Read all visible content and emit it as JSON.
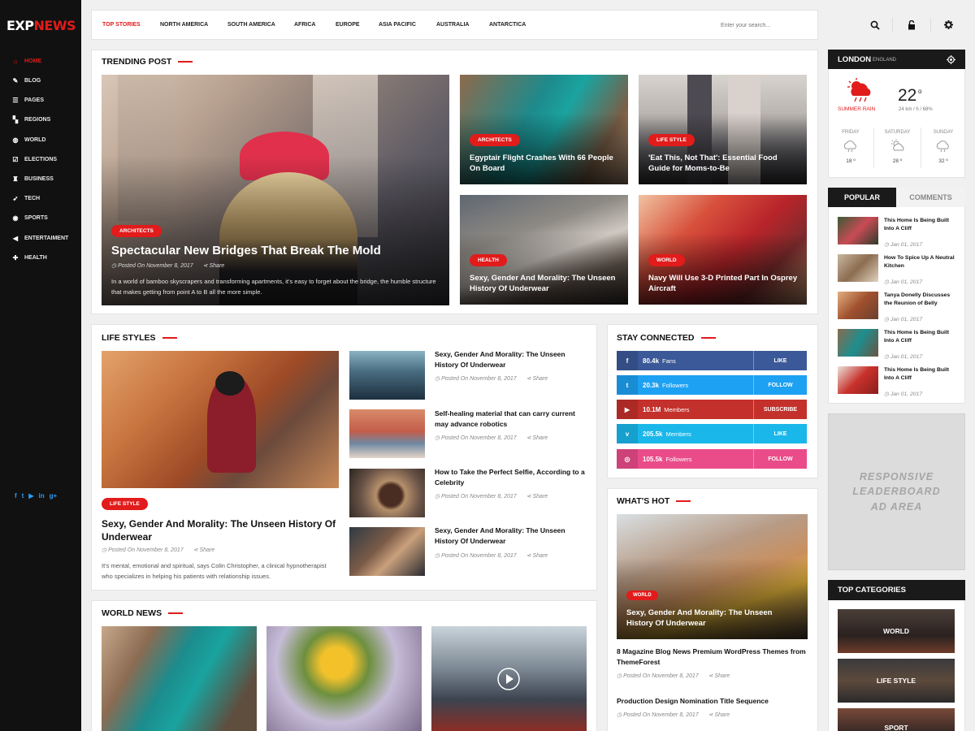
{
  "brand": {
    "logo_left": "EXP",
    "logo_right": "NEWS",
    "accent": "#e21b1b"
  },
  "sidebar": {
    "items": [
      {
        "label": "Home",
        "icon": "home-icon",
        "glyph": "⌂"
      },
      {
        "label": "Blog",
        "icon": "edit-icon",
        "glyph": "✎"
      },
      {
        "label": "Pages",
        "icon": "pages-icon",
        "glyph": "☰"
      },
      {
        "label": "Regions",
        "icon": "map-icon",
        "glyph": "▚"
      },
      {
        "label": "World",
        "icon": "globe-icon",
        "glyph": "◍"
      },
      {
        "label": "Elections",
        "icon": "vote-icon",
        "glyph": "☑"
      },
      {
        "label": "Business",
        "icon": "business-icon",
        "glyph": "♜"
      },
      {
        "label": "Tech",
        "icon": "rocket-icon",
        "glyph": "➶"
      },
      {
        "label": "Sports",
        "icon": "ball-icon",
        "glyph": "◉"
      },
      {
        "label": "Entertaiment",
        "icon": "megaphone-icon",
        "glyph": "◀"
      },
      {
        "label": "Health",
        "icon": "medkit-icon",
        "glyph": "✚"
      }
    ],
    "social": [
      "f",
      "t",
      "▶",
      "in",
      "g+"
    ]
  },
  "topnav": {
    "items": [
      "TOP STORIES",
      "NORTH AMERICA",
      "SOUTH AMERICA",
      "AFRICA",
      "EUROPE",
      "ASIA PACIFIC",
      "AUSTRALIA",
      "ANTARCTICA"
    ],
    "search_placeholder": "Enter your search..."
  },
  "trending": {
    "title": "Trending Post",
    "main": {
      "category": "Architects",
      "title": "Spectacular New Bridges That Break The Mold",
      "date": "Posted On November 8, 2017",
      "share": "Share",
      "excerpt": "In a world of bamboo skyscrapers and transforming apartments, it's easy to forget about the bridge, the humble structure that makes getting from point A to B all the more simple."
    },
    "cards": [
      {
        "category": "Architects",
        "title": "Egyptair Flight Crashes With 66 People On Board"
      },
      {
        "category": "Life Style",
        "title": "'Eat This, Not That': Essential Food Guide for Moms-to-Be"
      },
      {
        "category": "Health",
        "title": "Sexy, Gender And Morality: The Unseen History Of Underwear"
      },
      {
        "category": "World",
        "title": "Navy Will Use 3-D Printed Part In Osprey Aircraft"
      }
    ]
  },
  "lifestyles": {
    "title": "Life Styles",
    "main": {
      "category": "Life Style",
      "title": "Sexy, Gender And Morality: The Unseen History Of Underwear",
      "date": "Posted On November 8, 2017",
      "share": "Share",
      "excerpt": "It's mental, emotional and spiritual, says Colin Christopher, a clinical hypnotherapist who specializes in helping his patients with relationship issues."
    },
    "list": [
      {
        "title": "Sexy, Gender And Morality: The Unseen History Of Underwear",
        "date": "Posted On November 8, 2017",
        "share": "Share"
      },
      {
        "title": "Self-healing material that can carry current may advance robotics",
        "date": "Posted On November 8, 2017",
        "share": "Share"
      },
      {
        "title": "How to Take the Perfect Selfie, According to a Celebrity",
        "date": "Posted On November 8, 2017",
        "share": "Share"
      },
      {
        "title": "Sexy, Gender And Morality: The Unseen History Of Underwear",
        "date": "Posted On November 8, 2017",
        "share": "Share"
      }
    ]
  },
  "stay": {
    "title": "Stay Connected",
    "rows": [
      {
        "icon": "facebook-icon",
        "glyph": "f",
        "count": "80.4k",
        "unit": "Fans",
        "action": "LIKE",
        "color": "#3b5998"
      },
      {
        "icon": "twitter-icon",
        "glyph": "t",
        "count": "20.3k",
        "unit": "Followers",
        "action": "FOLLOW",
        "color": "#1da1f2"
      },
      {
        "icon": "youtube-icon",
        "glyph": "▶",
        "count": "10.1M",
        "unit": "Members",
        "action": "SUBSCRIBE",
        "color": "#c4302b"
      },
      {
        "icon": "vimeo-icon",
        "glyph": "v",
        "count": "205.5k",
        "unit": "Members",
        "action": "LIKE",
        "color": "#1ab7ea"
      },
      {
        "icon": "dribbble-icon",
        "glyph": "◎",
        "count": "105.5k",
        "unit": "Followers",
        "action": "FOLLOW",
        "color": "#ea4c89"
      }
    ]
  },
  "whatshot": {
    "title": "What's Hot",
    "main": {
      "category": "World",
      "title": "Sexy, Gender And Morality: The Unseen History Of Underwear"
    },
    "list": [
      {
        "title": "8 Magazine Blog News Premium WordPress Themes from ThemeForest",
        "date": "Posted On November 8, 2017",
        "share": "Share"
      },
      {
        "title": "Production Design Nomination Title Sequence",
        "date": "Posted On November 8, 2017",
        "share": "Share"
      }
    ]
  },
  "worldnews": {
    "title": "World News"
  },
  "weather": {
    "city": "London",
    "country": "England",
    "condition": "Summer Rain",
    "temp": "22",
    "deg": "o",
    "wind": "24 km / h / 68%",
    "days": [
      {
        "day": "FRIDAY",
        "temp": "18 º",
        "icon": "cloud-icon"
      },
      {
        "day": "SATURDAY",
        "temp": "28 º",
        "icon": "partly-sunny-icon"
      },
      {
        "day": "SUNDAY",
        "temp": "32 º",
        "icon": "cloud-icon"
      }
    ]
  },
  "tabs": {
    "active": "POPULAR",
    "inactive": "COMMENTS"
  },
  "popular": [
    {
      "title": "This Home Is Being Built Into A Cliff",
      "date": "Jan 01, 2017"
    },
    {
      "title": "How To Spice Up A Neutral Kitchen",
      "date": "Jan 01, 2017"
    },
    {
      "title": "Tanya Donelly Discusses the Reunion of Belly",
      "date": "Jan 01, 2017"
    },
    {
      "title": "This Home Is Being Built Into A Cliff",
      "date": "Jan 01, 2017"
    },
    {
      "title": "This Home Is Being Built Into A Cliff",
      "date": "Jan 01, 2017"
    }
  ],
  "ad": {
    "text": "RESPONSIVE LEADERBOARD AD AREA"
  },
  "topcats": {
    "title": "Top Categories",
    "items": [
      "World",
      "Life Style",
      "Sport"
    ]
  }
}
